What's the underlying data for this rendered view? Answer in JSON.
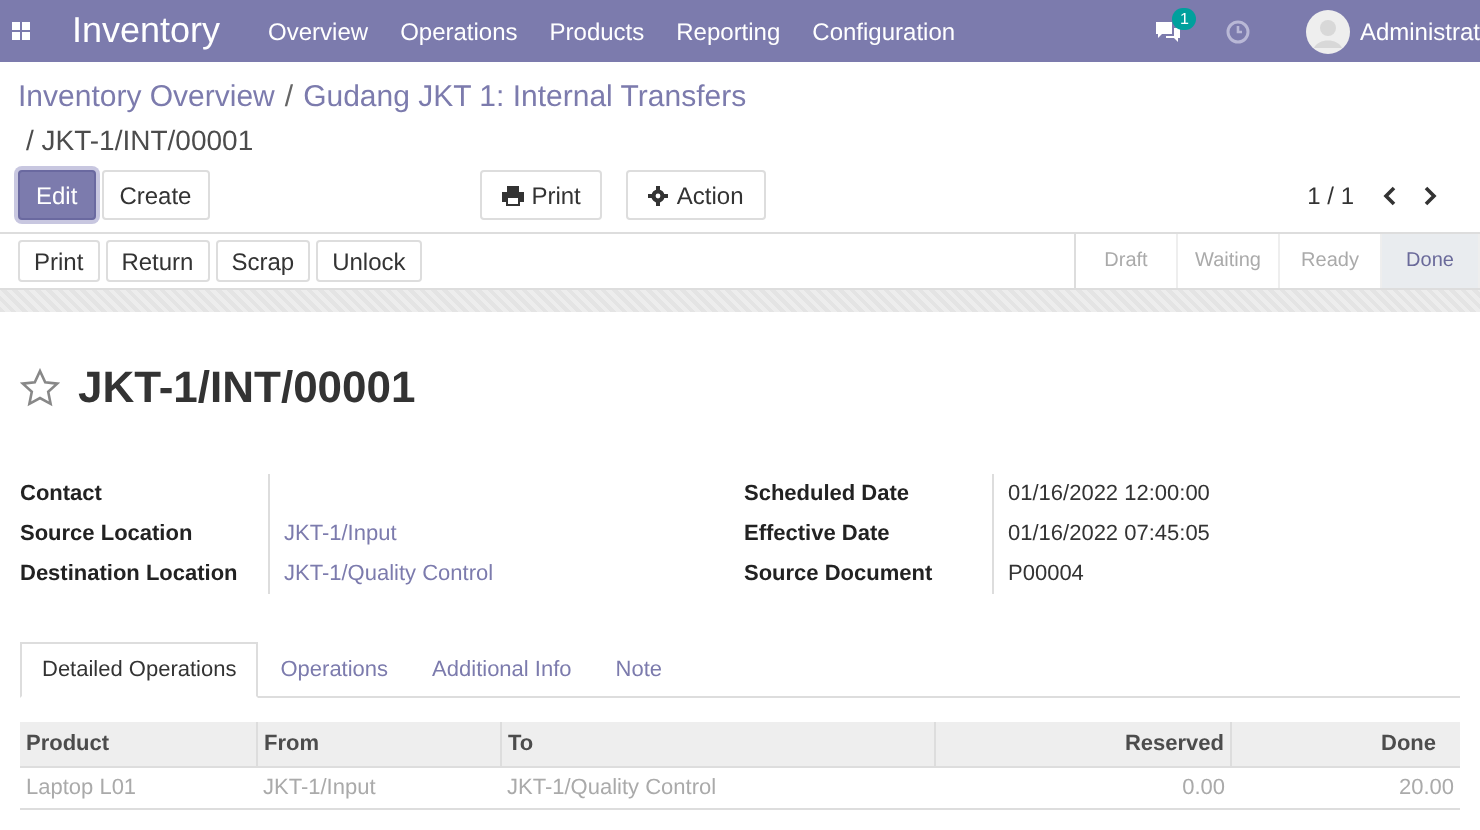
{
  "navbar": {
    "brand": "Inventory",
    "menu": [
      "Overview",
      "Operations",
      "Products",
      "Reporting",
      "Configuration"
    ],
    "message_count": "1",
    "user": "Administrat"
  },
  "breadcrumb": {
    "links": [
      {
        "label": "Inventory Overview",
        "separator": "/"
      },
      {
        "label": "Gudang JKT 1: Internal Transfers"
      }
    ],
    "current": "/ JKT-1/INT/00001"
  },
  "control_buttons": [
    {
      "label": "Edit",
      "kind": "primary"
    },
    {
      "label": "Create",
      "kind": "secondary"
    }
  ],
  "sidebar_buttons": [
    {
      "label": "Print",
      "kind": "print"
    },
    {
      "label": "Action",
      "kind": "gear"
    }
  ],
  "pager": {
    "value": "1 / 1"
  },
  "header_buttons": [
    "Print",
    "Return",
    "Scrap",
    "Unlock"
  ],
  "stages": [
    {
      "label": "Draft",
      "selected": false
    },
    {
      "label": "Waiting",
      "selected": false
    },
    {
      "label": "Ready",
      "selected": false
    },
    {
      "label": "Done",
      "selected": true
    }
  ],
  "record": {
    "starred": false,
    "title": "JKT-1/INT/00001"
  },
  "left_fields": [
    {
      "label": "Contact"
    },
    {
      "label": "Source Location",
      "value": "JKT-1/Input",
      "kind": "link"
    },
    {
      "label": "Destination Location",
      "value": "JKT-1/Quality Control",
      "kind": "link"
    }
  ],
  "right_fields": [
    {
      "label": "Scheduled Date",
      "value": "01/16/2022 12:00:00"
    },
    {
      "label": "Effective Date",
      "value": "01/16/2022 07:45:05"
    },
    {
      "label": "Source Document",
      "value": "P00004"
    }
  ],
  "tabs": [
    {
      "label": "Detailed Operations",
      "selected": true
    },
    {
      "label": "Operations",
      "selected": false
    },
    {
      "label": "Additional Info",
      "selected": false
    },
    {
      "label": "Note",
      "selected": false
    }
  ],
  "table": {
    "columns": [
      {
        "label": "Product",
        "numeric": false
      },
      {
        "label": "From",
        "numeric": false
      },
      {
        "label": "To",
        "numeric": false
      },
      {
        "label": "Reserved",
        "numeric": true
      },
      {
        "label": "Done",
        "numeric": true
      }
    ],
    "rows": [
      {
        "cells": [
          "Laptop L01",
          "JKT-1/Input",
          "JKT-1/Quality Control",
          "0.00",
          "20.00"
        ]
      }
    ]
  }
}
